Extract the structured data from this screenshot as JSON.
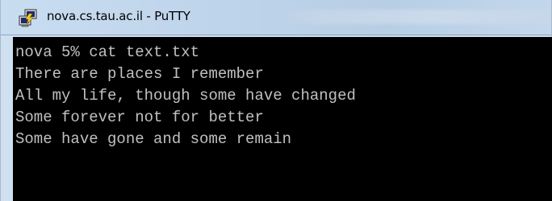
{
  "window": {
    "title": "nova.cs.tau.ac.il - PuTTY",
    "icon": "putty-icon"
  },
  "terminal": {
    "lines": [
      "nova 5% cat text.txt",
      "There are places I remember",
      "All my life, though some have changed",
      "Some forever not for better",
      "Some have gone and some remain"
    ],
    "background_color": "#000000",
    "text_color": "#c0c0c0"
  }
}
